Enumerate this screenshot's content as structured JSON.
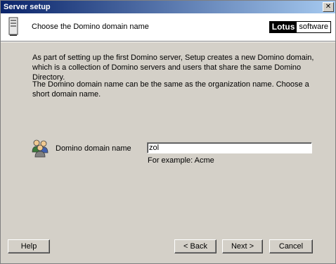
{
  "window": {
    "title": "Server setup",
    "close_glyph": "✕"
  },
  "header": {
    "title": "Choose the Domino domain name",
    "icon": "server-icon",
    "logo": {
      "part1": "Lotus",
      "part2": "software"
    }
  },
  "body": {
    "paragraph1": "As part of setting up the first Domino server, Setup creates a new Domino domain, which is a collection of Domino servers and users that share the same Domino Directory.",
    "paragraph2": "The Domino domain name can be the same as the organization name. Choose a short domain name."
  },
  "field": {
    "icon": "users-group-icon",
    "label": "Domino domain name",
    "value": "zol",
    "hint": "For example: Acme"
  },
  "buttons": {
    "help": "Help",
    "back": "< Back",
    "next": "Next >",
    "cancel": "Cancel"
  }
}
